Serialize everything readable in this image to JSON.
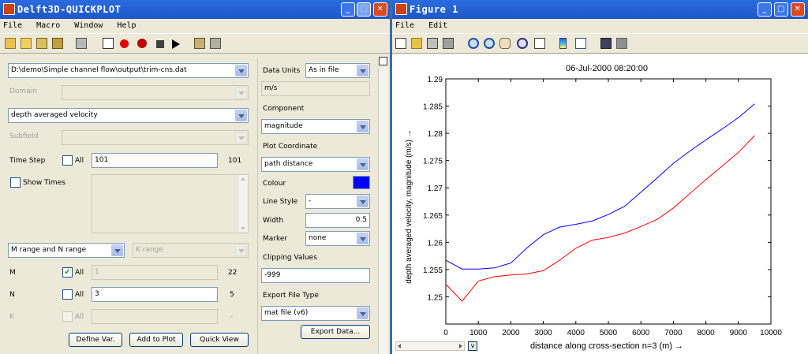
{
  "left_window": {
    "title": "Delft3D-QUICKPLOT",
    "menu": [
      "File",
      "Macro",
      "Window",
      "Help"
    ],
    "file_path": "D:\\demo\\Simple channel flow\\output\\trim-cns.dat",
    "domain_label": "Domain",
    "quantity": "depth averaged velocity",
    "subfield_label": "Subfield",
    "time_step_label": "Time Step",
    "all_label": "All",
    "time_step_value": "101",
    "time_step_max": "101",
    "show_times_label": "Show Times",
    "range_mode": "M range and N range",
    "k_range_placeholder": "K range",
    "m_label": "M",
    "m_value": "1",
    "m_max": "22",
    "n_label": "N",
    "n_value": "3",
    "n_max": "5",
    "k_label": "K",
    "k_max": "-",
    "define_var_label": "Define Var.",
    "add_to_plot_label": "Add to Plot",
    "quick_view_label": "Quick View",
    "data_units_label": "Data Units",
    "data_units_value": "As in file",
    "units": "m/s",
    "component_label": "Component",
    "component_value": "magnitude",
    "plot_coordinate_label": "Plot Coordinate",
    "plot_coordinate_value": "path distance",
    "colour_label": "Colour",
    "colour_value": "#0000ff",
    "line_style_label": "Line Style",
    "line_style_value": "-",
    "width_label": "Width",
    "width_value": "0.5",
    "marker_label": "Marker",
    "marker_value": "none",
    "clipping_label": "Clipping Values",
    "clipping_value": "-999",
    "export_type_label": "Export File Type",
    "export_type_value": "mat file (v6)",
    "export_data_label": "Export Data..."
  },
  "right_window": {
    "title": "Figure 1",
    "menu": [
      "File",
      "Edit"
    ],
    "scroll_button_label": "v"
  },
  "chart_data": {
    "type": "line",
    "title": "06-Jul-2000 08:20:00",
    "xlabel": "distance along cross-section n=3 (m) →",
    "ylabel": "depth averaged velocity, magnitude (m/s) →",
    "xlim": [
      0,
      10000
    ],
    "ylim": [
      1.245,
      1.29
    ],
    "xticks": [
      "0",
      "1000",
      "2000",
      "3000",
      "4000",
      "5000",
      "6000",
      "7000",
      "8000",
      "9000",
      "10000"
    ],
    "yticks": [
      "1.25",
      "1.255",
      "1.26",
      "1.265",
      "1.27",
      "1.275",
      "1.28",
      "1.285",
      "1.29"
    ],
    "grid": false,
    "series": [
      {
        "color": "#0000ff",
        "x": [
          0,
          500,
          1000,
          1500,
          2000,
          2500,
          3000,
          3500,
          4000,
          4500,
          5000,
          5500,
          6000,
          6500,
          7000,
          7500,
          8000,
          8500,
          9000,
          9500
        ],
        "y": [
          1.2567,
          1.2551,
          1.2551,
          1.2553,
          1.2562,
          1.259,
          1.2614,
          1.2628,
          1.2633,
          1.2639,
          1.2651,
          1.2666,
          1.2692,
          1.2718,
          1.2745,
          1.2767,
          1.2788,
          1.2808,
          1.2829,
          1.2854
        ]
      },
      {
        "color": "#ff0000",
        "x": [
          0,
          500,
          1000,
          1500,
          2000,
          2500,
          3000,
          3500,
          4000,
          4500,
          5000,
          5500,
          6000,
          6500,
          7000,
          7500,
          8000,
          8500,
          9000,
          9500
        ],
        "y": [
          1.2523,
          1.2492,
          1.2529,
          1.2537,
          1.254,
          1.2542,
          1.2548,
          1.2567,
          1.2589,
          1.2604,
          1.2609,
          1.2617,
          1.2629,
          1.2642,
          1.2663,
          1.2689,
          1.2715,
          1.274,
          1.2765,
          1.2796
        ]
      }
    ]
  }
}
